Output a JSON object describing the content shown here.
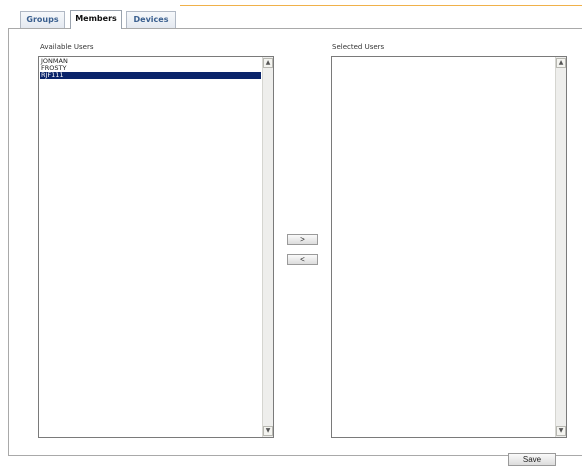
{
  "tabs": [
    {
      "label": "Groups",
      "active": false
    },
    {
      "label": "Members",
      "active": true
    },
    {
      "label": "Devices",
      "active": false
    }
  ],
  "available_users": {
    "label": "Available Users",
    "items": [
      "JONMAN",
      "FROSTY",
      "RJF111"
    ],
    "selected": "RJF111"
  },
  "selected_users": {
    "label": "Selected Users",
    "items": []
  },
  "buttons": {
    "add": ">",
    "remove": "<",
    "save": "Save"
  },
  "icons": {
    "scroll_up": "scroll-up-arrow",
    "scroll_down": "scroll-down-arrow"
  },
  "colors": {
    "selection": "#0a246a",
    "tab_text": "#3a5f8f",
    "accent": "#f0b14a"
  }
}
